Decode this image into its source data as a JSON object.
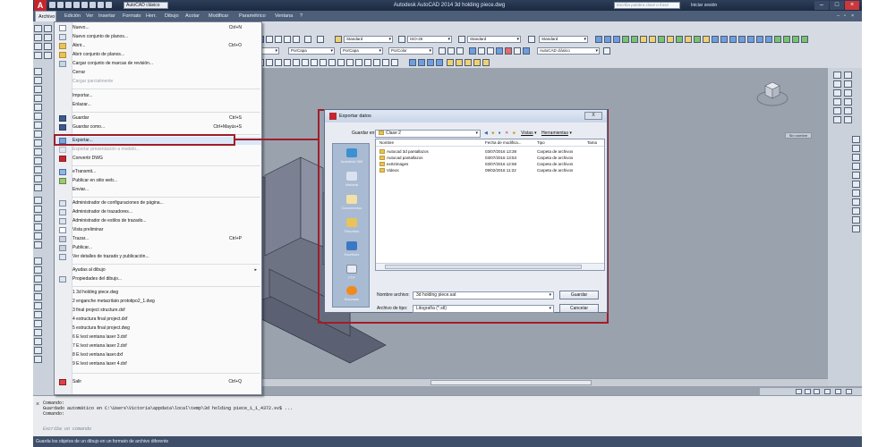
{
  "app": {
    "window_title": "Autodesk AutoCAD 2014   3d holding piece.dwg",
    "workspace": "AutoCAD clásico",
    "search_placeholder": "Escriba palabra clave o frase",
    "signin": "Iniciar sesión",
    "accent": "#a01d2a"
  },
  "menubar": [
    "Archivo",
    "Edición",
    "Ver",
    "Insertar",
    "Formato",
    "Herr.",
    "Dibujo",
    "Acotar",
    "Modificar",
    "Paramétrico",
    "Ventana",
    "?"
  ],
  "ribbon": {
    "text_style": "Standard",
    "dim_style": "ISO-25",
    "table_style": "Standard",
    "multileader_style": "Standard",
    "layer": "0",
    "color": "PorCapa",
    "linetype": "PorCapa",
    "lineweight": "PorColor",
    "workspace_combo": "AutoCAD clásico"
  },
  "file_menu": {
    "items": [
      {
        "label": "Nuevo...",
        "shortcut": "Ctrl+N"
      },
      {
        "label": "Nuevo conjunto de planos...",
        "shortcut": ""
      },
      {
        "label": "Abrir...",
        "shortcut": "Ctrl+O"
      },
      {
        "label": "Abrir conjunto de planos...",
        "shortcut": ""
      },
      {
        "label": "Cargar conjunto de marcas de revisión...",
        "shortcut": ""
      },
      {
        "label": "Cerrar",
        "shortcut": ""
      },
      {
        "label": "Cargar parcialmente",
        "shortcut": ""
      },
      {
        "label": "Importar...",
        "shortcut": ""
      },
      {
        "label": "Enlazar...",
        "shortcut": ""
      },
      {
        "label": "Guardar",
        "shortcut": "Ctrl+S"
      },
      {
        "label": "Guardar como...",
        "shortcut": "Ctrl+Mayús+S"
      },
      {
        "label": "Exportar...",
        "shortcut": ""
      },
      {
        "label": "Exportar presentación a modelo...",
        "shortcut": ""
      },
      {
        "label": "Convertir DWG",
        "shortcut": ""
      },
      {
        "label": "eTransmit...",
        "shortcut": ""
      },
      {
        "label": "Publicar en sitio web...",
        "shortcut": ""
      },
      {
        "label": "Enviar...",
        "shortcut": ""
      },
      {
        "label": "Administrador de configuraciones de página...",
        "shortcut": ""
      },
      {
        "label": "Administrador de trazadores...",
        "shortcut": ""
      },
      {
        "label": "Administrador de estilos de trazado...",
        "shortcut": ""
      },
      {
        "label": "Vista preliminar",
        "shortcut": ""
      },
      {
        "label": "Trazar...",
        "shortcut": "Ctrl+P"
      },
      {
        "label": "Publicar...",
        "shortcut": ""
      },
      {
        "label": "Ver detalles de trazado y publicación...",
        "shortcut": ""
      },
      {
        "label": "Ayudas al dibujo",
        "shortcut": ""
      },
      {
        "label": "Propiedades del dibujo...",
        "shortcut": ""
      },
      {
        "label": "1 3d holding piece.dwg",
        "shortcut": ""
      },
      {
        "label": "2 enganche metacrilato prototipo2_1.dwg",
        "shortcut": ""
      },
      {
        "label": "3 final project structure.dxf",
        "shortcut": ""
      },
      {
        "label": "4 estructura final project.dxf",
        "shortcut": ""
      },
      {
        "label": "5 estructura final project.dwg",
        "shortcut": ""
      },
      {
        "label": "6 E:\\est ventana laser 3.dxf",
        "shortcut": ""
      },
      {
        "label": "7 E:\\est ventana laser 2.dxf",
        "shortcut": ""
      },
      {
        "label": "8 E:\\est ventana laser.dxf",
        "shortcut": ""
      },
      {
        "label": "9 E:\\est ventana laser 4.dxf",
        "shortcut": ""
      },
      {
        "label": "Salir",
        "shortcut": "Ctrl+Q"
      }
    ]
  },
  "dialog": {
    "title": "Exportar datos",
    "close": "X",
    "save_in_label": "Guardar en:",
    "save_in_value": "Clase 2",
    "tools_views": "Vistas",
    "tools_tools": "Herramientas",
    "places": [
      "Autodesk 360",
      "Historial",
      "Documentos",
      "Favoritos",
      "Escritorio",
      "FTP",
      "Buzzsaw"
    ],
    "columns": [
      "Nombre",
      "Fecha de modifica...",
      "Tipo",
      "Tama"
    ],
    "files": [
      {
        "name": "Autocad 3d pantallazos",
        "date": "03/07/2016 13:38",
        "type": "Carpeta de archivos"
      },
      {
        "name": "Autocad pantallazos",
        "date": "03/07/2016 13:53",
        "type": "Carpeta de archivos"
      },
      {
        "name": "ex02images",
        "date": "03/07/2016 12:58",
        "type": "Carpeta de archivos"
      },
      {
        "name": "Videos",
        "date": "09/02/2016 11:22",
        "type": "Carpeta de archivos"
      }
    ],
    "filename_label": "Nombre archivo:",
    "filename_value": "3d holding piece.sat",
    "filetype_label": "Archivo de tipo:",
    "filetype_value": "Litografía (*.stl)",
    "save_button": "Guardar",
    "cancel_button": "Cancelar"
  },
  "viewport": {
    "nav_label": "Sin nombre"
  },
  "command": {
    "lines": [
      "Comando:",
      "Guardado automático en C:\\Users\\Victoria\\appdata\\local\\temp\\3d holding piece_1_1_4372.sv$ ...",
      "Comando:"
    ],
    "placeholder": "Escriba un comando"
  },
  "status_message": "Guarda los objetos de un dibujo en un formato de archivo diferente",
  "model_tab": "Mod"
}
